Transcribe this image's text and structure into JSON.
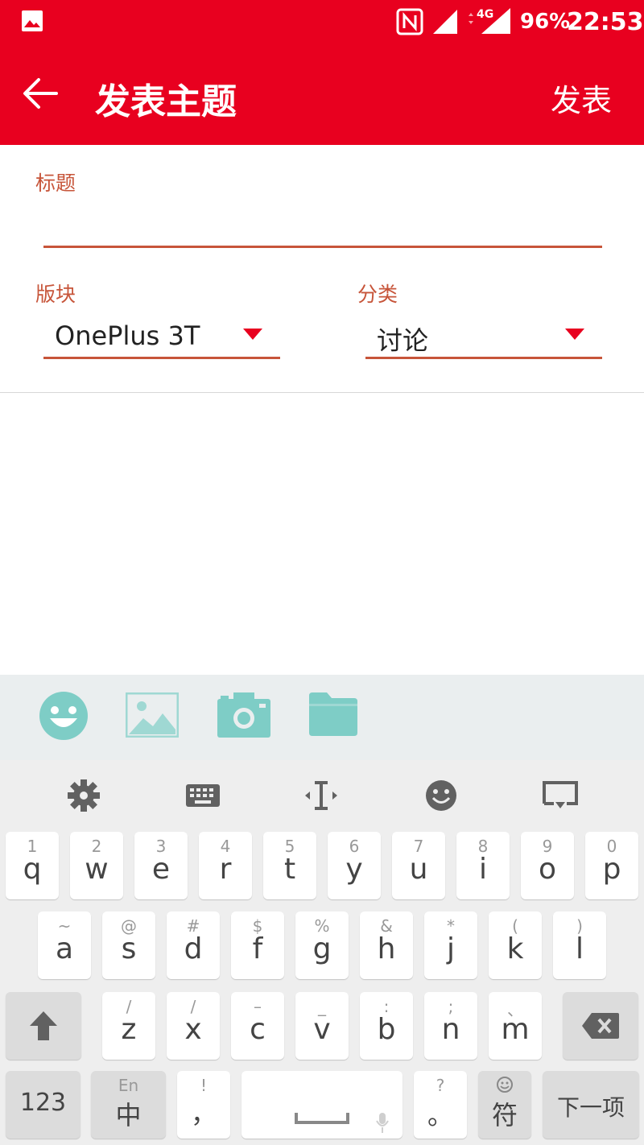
{
  "status_bar": {
    "battery": "96%",
    "time": "22:53",
    "network": "4G"
  },
  "app_bar": {
    "title": "发表主题",
    "action": "发表"
  },
  "form": {
    "title_label": "标题",
    "title_value": "",
    "board_label": "版块",
    "board_value": "OnePlus 3T",
    "category_label": "分类",
    "category_value": "讨论"
  },
  "attachments": [
    "emoji-icon",
    "image-icon",
    "camera-icon",
    "folder-icon"
  ],
  "keyboard": {
    "toolbar": [
      "settings-icon",
      "keyboard-icon",
      "cursor-move-icon",
      "emoji-icon",
      "hide-keyboard-icon"
    ],
    "row1": [
      {
        "hint": "1",
        "key": "q"
      },
      {
        "hint": "2",
        "key": "w"
      },
      {
        "hint": "3",
        "key": "e"
      },
      {
        "hint": "4",
        "key": "r"
      },
      {
        "hint": "5",
        "key": "t"
      },
      {
        "hint": "6",
        "key": "y"
      },
      {
        "hint": "7",
        "key": "u"
      },
      {
        "hint": "8",
        "key": "i"
      },
      {
        "hint": "9",
        "key": "o"
      },
      {
        "hint": "0",
        "key": "p"
      }
    ],
    "row2": [
      {
        "hint": "~",
        "key": "a"
      },
      {
        "hint": "@",
        "key": "s"
      },
      {
        "hint": "#",
        "key": "d"
      },
      {
        "hint": "$",
        "key": "f"
      },
      {
        "hint": "%",
        "key": "g"
      },
      {
        "hint": "&",
        "key": "h"
      },
      {
        "hint": "*",
        "key": "j"
      },
      {
        "hint": "(",
        "key": "k"
      },
      {
        "hint": ")",
        "key": "l"
      }
    ],
    "row3": [
      {
        "hint": "/",
        "key": "z"
      },
      {
        "hint": "/",
        "key": "x"
      },
      {
        "hint": "–",
        "key": "c"
      },
      {
        "hint": "_",
        "key": "v"
      },
      {
        "hint": ":",
        "key": "b"
      },
      {
        "hint": ";",
        "key": "n"
      },
      {
        "hint": "、",
        "key": "m"
      }
    ],
    "bottom": {
      "numbers": "123",
      "lang_hint": "En",
      "lang": "中",
      "comma_hint": "!",
      "comma": "，",
      "period_hint": "?",
      "period": "。",
      "symbols": "符",
      "next": "下一项"
    }
  }
}
